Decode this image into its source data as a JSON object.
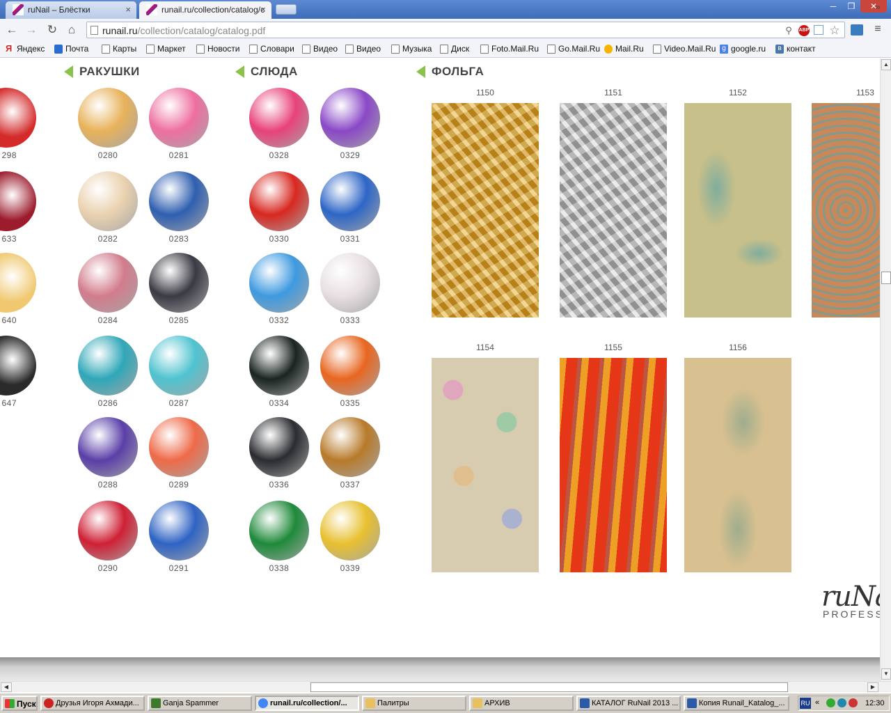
{
  "browser": {
    "tabs": [
      {
        "title": "ruNail – Блёстки",
        "close": "×"
      },
      {
        "title": "runail.ru/collection/catalog/c",
        "close": "×"
      }
    ],
    "window_buttons": {
      "minimize": "─",
      "maximize": "❐",
      "close": "✕"
    },
    "nav": {
      "back": "←",
      "forward": "→",
      "reload": "↻",
      "home": "⌂"
    },
    "address": {
      "host": "runail.ru",
      "path": "/collection/catalog/catalog.pdf"
    },
    "omnibox_icons": {
      "zoom": "⚲",
      "adblock": "ABP",
      "star": "☆"
    },
    "menu": "≡",
    "bookmarks": [
      {
        "label": "Яндекс",
        "icon": "yandex-icon"
      },
      {
        "label": "Почта",
        "icon": "mail-icon"
      },
      {
        "label": "Карты",
        "icon": "page-icon"
      },
      {
        "label": "Маркет",
        "icon": "page-icon"
      },
      {
        "label": "Новости",
        "icon": "page-icon"
      },
      {
        "label": "Словари",
        "icon": "page-icon"
      },
      {
        "label": "Видео",
        "icon": "page-icon"
      },
      {
        "label": "Видео",
        "icon": "page-icon"
      },
      {
        "label": "Музыка",
        "icon": "page-icon"
      },
      {
        "label": "Диск",
        "icon": "page-icon"
      },
      {
        "label": "Foto.Mail.Ru",
        "icon": "page-icon"
      },
      {
        "label": "Go.Mail.Ru",
        "icon": "page-icon"
      },
      {
        "label": "Mail.Ru",
        "icon": "mailru-at-icon"
      },
      {
        "label": "Video.Mail.Ru",
        "icon": "page-icon"
      },
      {
        "label": "google.ru",
        "icon": "google-icon"
      },
      {
        "label": "контакт",
        "icon": "vk-icon"
      }
    ],
    "bookmarks_more": "»"
  },
  "catalog": {
    "sections": {
      "shells": "РАКУШКИ",
      "mica": "СЛЮДА",
      "foil": "ФОЛЬГА"
    },
    "left_partial_codes": [
      "298",
      "633",
      "640",
      "647"
    ],
    "shells": [
      "0280",
      "0281",
      "0282",
      "0283",
      "0284",
      "0285",
      "0286",
      "0287",
      "0288",
      "0289",
      "0290",
      "0291"
    ],
    "mica": [
      "0328",
      "0329",
      "0330",
      "0331",
      "0332",
      "0333",
      "0334",
      "0335",
      "0336",
      "0337",
      "0338",
      "0339"
    ],
    "foil": [
      "1150",
      "1151",
      "1152",
      "1153",
      "1154",
      "1155",
      "1156"
    ],
    "brand": {
      "name": "ruNa",
      "sub": "PROFESS"
    }
  },
  "swatch_colors": {
    "left_partial": [
      "#d42a2a",
      "#9c1b2c",
      "#f0c870",
      "#2a2a2a"
    ],
    "shells": [
      "#e8b25a",
      "#ee6fa0",
      "#ead2b0",
      "#2f5fb0",
      "#d27c8c",
      "#3a3a44",
      "#2fa7b8",
      "#4fc3d0",
      "#5a3fa8",
      "#ee6a48",
      "#cf2035",
      "#2f63c4"
    ],
    "mica": [
      "#e8427a",
      "#8a48c6",
      "#d82820",
      "#2d66c6",
      "#3e9ae0",
      "#e8e0e2",
      "#1a2420",
      "#e86620",
      "#2a2c30",
      "#b87a2a",
      "#1e8a3a",
      "#e8c030"
    ],
    "foil": [
      "#e0a020",
      "#bcbcbc",
      "#c8c08a",
      "#c8885a",
      "#d8ccb0",
      "#e84020",
      "#d8c090"
    ]
  },
  "taskbar": {
    "start": "Пуск",
    "tasks": [
      "Друзья Игоря Ахмади...",
      "Ganja Spammer",
      "runail.ru/collection/...",
      "Палитры",
      "АРХИВ",
      "КАТАЛОГ RuNail 2013 ...",
      "Копия Runail_Katalog_..."
    ],
    "tray_lang": "RU",
    "tray_arrows": "«",
    "clock": "12:30"
  }
}
